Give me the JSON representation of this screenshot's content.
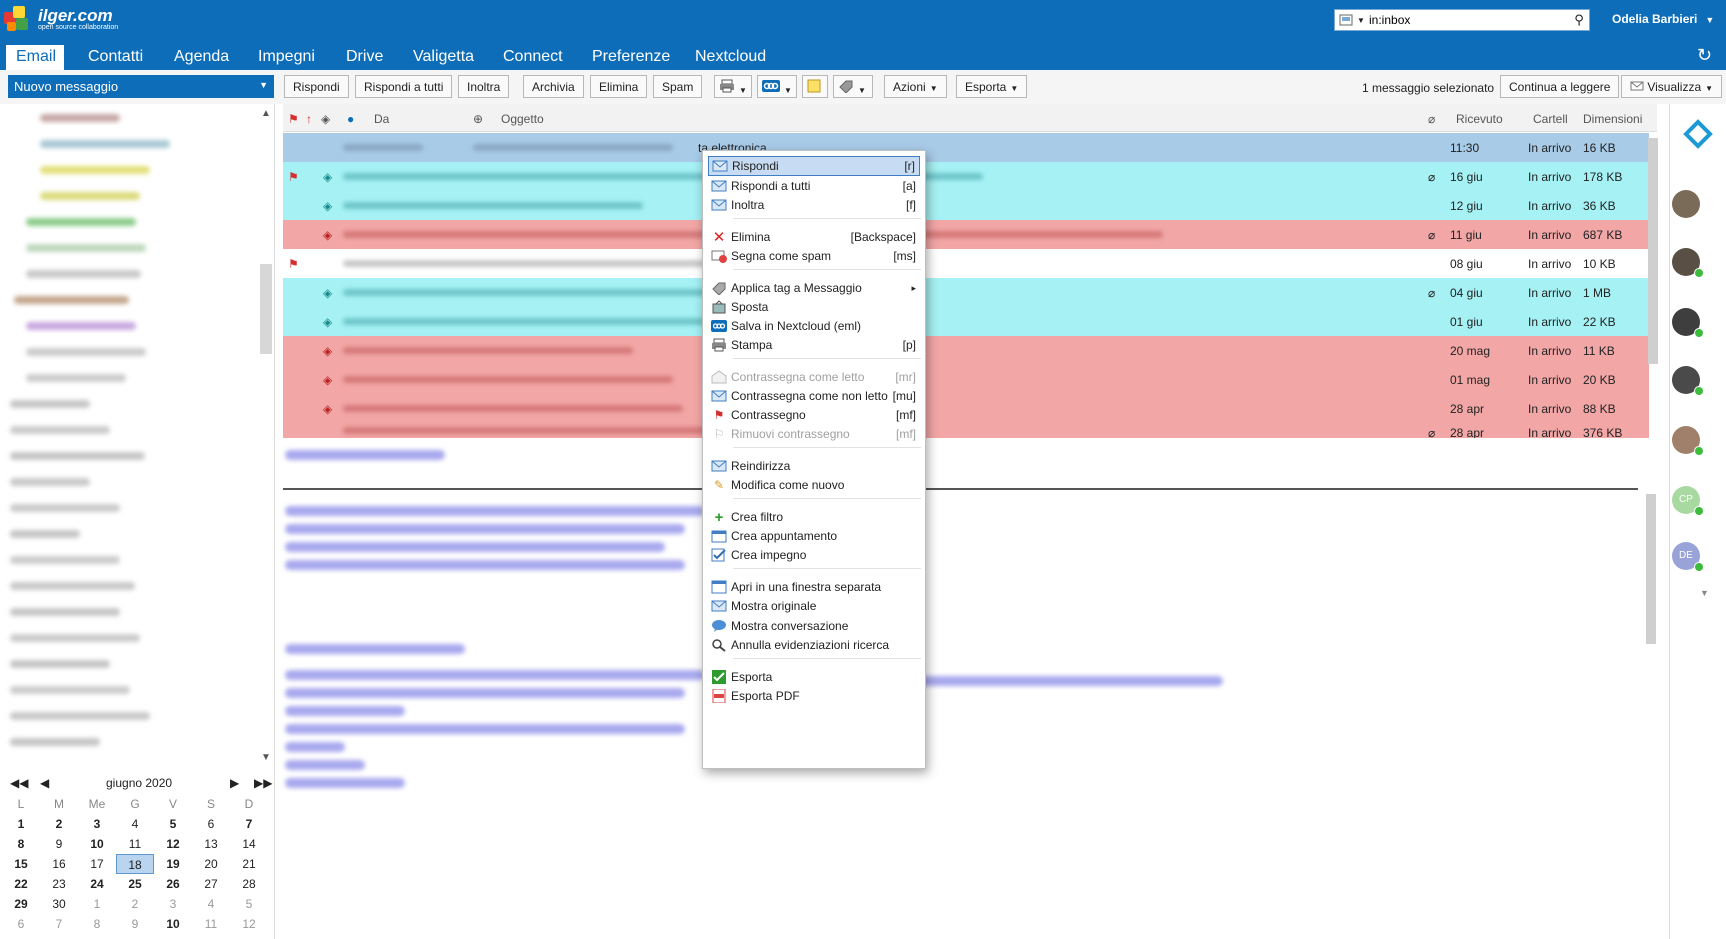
{
  "brand": {
    "name": "ilger.com",
    "tagline": "open source collaboration"
  },
  "search": {
    "value": "in:inbox"
  },
  "user": {
    "name": "Odelia Barbieri"
  },
  "nav": {
    "tabs": [
      "Email",
      "Contatti",
      "Agenda",
      "Impegni",
      "Drive",
      "Valigetta",
      "Connect",
      "Preferenze",
      "Nextcloud"
    ]
  },
  "toolbar": {
    "new_message": "Nuovo messaggio",
    "reply": "Rispondi",
    "reply_all": "Rispondi a tutti",
    "forward": "Inoltra",
    "archive": "Archivia",
    "delete": "Elimina",
    "spam": "Spam",
    "actions": "Azioni",
    "export": "Esporta",
    "status": "1 messaggio selezionato",
    "continue_reading": "Continua a leggere",
    "view": "Visualizza"
  },
  "list": {
    "columns": {
      "from": "Da",
      "subject": "Oggetto",
      "received": "Ricevuto",
      "folder": "Cartell",
      "size": "Dimensioni"
    },
    "rows": [
      {
        "subject_tail": "ta elettronica",
        "received": "11:30",
        "folder": "In arrivo",
        "size": "16 KB"
      },
      {
        "received": "16 giu",
        "folder": "In arrivo",
        "size": "178 KB"
      },
      {
        "received": "12 giu",
        "folder": "In arrivo",
        "size": "36 KB"
      },
      {
        "received": "11 giu",
        "folder": "In arrivo",
        "size": "687 KB"
      },
      {
        "received": "08 giu",
        "folder": "In arrivo",
        "size": "10 KB"
      },
      {
        "received": "04 giu",
        "folder": "In arrivo",
        "size": "1 MB"
      },
      {
        "received": "01 giu",
        "folder": "In arrivo",
        "size": "22 KB"
      },
      {
        "received": "20 mag",
        "folder": "In arrivo",
        "size": "11 KB"
      },
      {
        "received": "01 mag",
        "folder": "In arrivo",
        "size": "20 KB"
      },
      {
        "received": "28 apr",
        "folder": "In arrivo",
        "size": "88 KB"
      },
      {
        "received": "28 apr",
        "folder": "In arrivo",
        "size": "376 KB"
      }
    ]
  },
  "calendar": {
    "month_label": "giugno 2020",
    "dow": [
      "L",
      "M",
      "Me",
      "G",
      "V",
      "S",
      "D"
    ],
    "weeks": [
      [
        "1",
        "2",
        "3",
        "4",
        "5",
        "6",
        "7"
      ],
      [
        "8",
        "9",
        "10",
        "11",
        "12",
        "13",
        "14"
      ],
      [
        "15",
        "16",
        "17",
        "18",
        "19",
        "20",
        "21"
      ],
      [
        "22",
        "23",
        "24",
        "25",
        "26",
        "27",
        "28"
      ],
      [
        "29",
        "30",
        "1",
        "2",
        "3",
        "4",
        "5"
      ],
      [
        "6",
        "7",
        "8",
        "9",
        "10",
        "11",
        "12"
      ]
    ],
    "selected": "18"
  },
  "avatars": {
    "cp": "CP",
    "de": "DE"
  },
  "context_menu": {
    "items": [
      {
        "label": "Rispondi",
        "shortcut": "[r]"
      },
      {
        "label": "Rispondi a tutti",
        "shortcut": "[a]"
      },
      {
        "label": "Inoltra",
        "shortcut": "[f]"
      },
      {
        "label": "Elimina",
        "shortcut": "[Backspace]"
      },
      {
        "label": "Segna come spam",
        "shortcut": "[ms]"
      },
      {
        "label": "Applica tag a Messaggio",
        "shortcut": "▸"
      },
      {
        "label": "Sposta",
        "shortcut": ""
      },
      {
        "label": "Salva in Nextcloud (eml)",
        "shortcut": ""
      },
      {
        "label": "Stampa",
        "shortcut": "[p]"
      },
      {
        "label": "Contrassegna come letto",
        "shortcut": "[mr]"
      },
      {
        "label": "Contrassegna come non letto",
        "shortcut": "[mu]"
      },
      {
        "label": "Contrassegno",
        "shortcut": "[mf]"
      },
      {
        "label": "Rimuovi contrassegno",
        "shortcut": "[mf]"
      },
      {
        "label": "Reindirizza",
        "shortcut": ""
      },
      {
        "label": "Modifica come nuovo",
        "shortcut": ""
      },
      {
        "label": "Crea filtro",
        "shortcut": ""
      },
      {
        "label": "Crea appuntamento",
        "shortcut": ""
      },
      {
        "label": "Crea impegno",
        "shortcut": ""
      },
      {
        "label": "Apri in una finestra separata",
        "shortcut": ""
      },
      {
        "label": "Mostra originale",
        "shortcut": ""
      },
      {
        "label": "Mostra conversazione",
        "shortcut": ""
      },
      {
        "label": "Annulla evidenziazioni ricerca",
        "shortcut": ""
      },
      {
        "label": "Esporta",
        "shortcut": ""
      },
      {
        "label": "Esporta PDF",
        "shortcut": ""
      }
    ]
  }
}
